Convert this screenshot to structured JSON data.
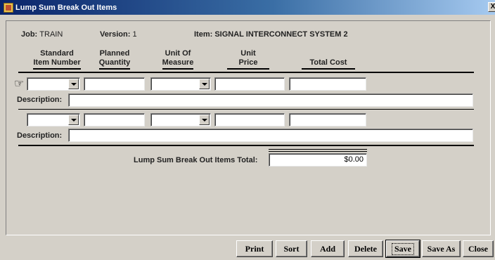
{
  "window": {
    "title": "Lump Sum Break Out Items",
    "close_glyph": "X"
  },
  "info": {
    "job_label": "Job:",
    "job_value": "TRAIN",
    "version_label": "Version:",
    "version_value": "1",
    "item_label": "Item:",
    "item_value": "SIGNAL INTERCONNECT SYSTEM 2"
  },
  "columns": {
    "std_line1": "Standard",
    "std_line2": "Item Number",
    "qty_line1": "Planned",
    "qty_line2": "Quantity",
    "uom_line1": "Unit Of",
    "uom_line2": "Measure",
    "price_line1": "Unit",
    "price_line2": "Price",
    "total": "Total Cost"
  },
  "rows": [
    {
      "std_item": "",
      "quantity": "",
      "unit": "",
      "unit_price": "",
      "total_cost": "",
      "description_label": "Description:",
      "description": ""
    },
    {
      "std_item": "",
      "quantity": "",
      "unit": "",
      "unit_price": "",
      "total_cost": "",
      "description_label": "Description:",
      "description": ""
    }
  ],
  "total": {
    "label": "Lump Sum Break Out Items Total:",
    "value": "$0.00"
  },
  "buttons": {
    "print": "Print",
    "sort": "Sort",
    "add": "Add",
    "delete": "Delete",
    "save": "Save",
    "save_as": "Save As",
    "close": "Close"
  },
  "icons": {
    "pointer": "pointing-hand-icon"
  }
}
